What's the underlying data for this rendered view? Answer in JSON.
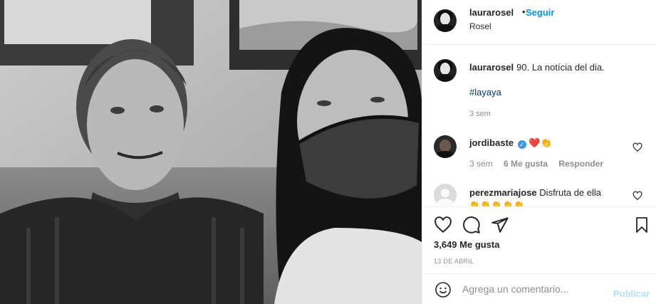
{
  "post": {
    "username": "laurarosel",
    "follow_label": "Seguir",
    "location": "Rosel",
    "dot": "•"
  },
  "caption": {
    "username": "laurarosel",
    "text": "90. La notícia del dia.",
    "hashtag": "#layaya",
    "time": "3 sem"
  },
  "comments": [
    {
      "username": "jordibaste",
      "verified": true,
      "text": "❤️👏",
      "time": "3 sem",
      "likes": "6 Me gusta",
      "reply": "Responder"
    },
    {
      "username": "perezmariajose",
      "text": "Disfruta de ella",
      "emoji_line": "👏👏👏👏👏"
    }
  ],
  "stats": {
    "likes": "3,649 Me gusta",
    "date": "13 DE ABRIL"
  },
  "add_comment": {
    "placeholder": "Agrega un comentario...",
    "publish_label": "Publicar"
  },
  "icons": [
    "heart-icon",
    "comment-icon",
    "share-icon",
    "bookmark-icon",
    "emoji-icon",
    "verified-badge-icon"
  ],
  "colors": {
    "link": "#0095f6",
    "hashtag": "#00376b",
    "secondary_text": "#8e8e8e",
    "publish_disabled": "#b2dffc",
    "verified": "#3897f0"
  }
}
